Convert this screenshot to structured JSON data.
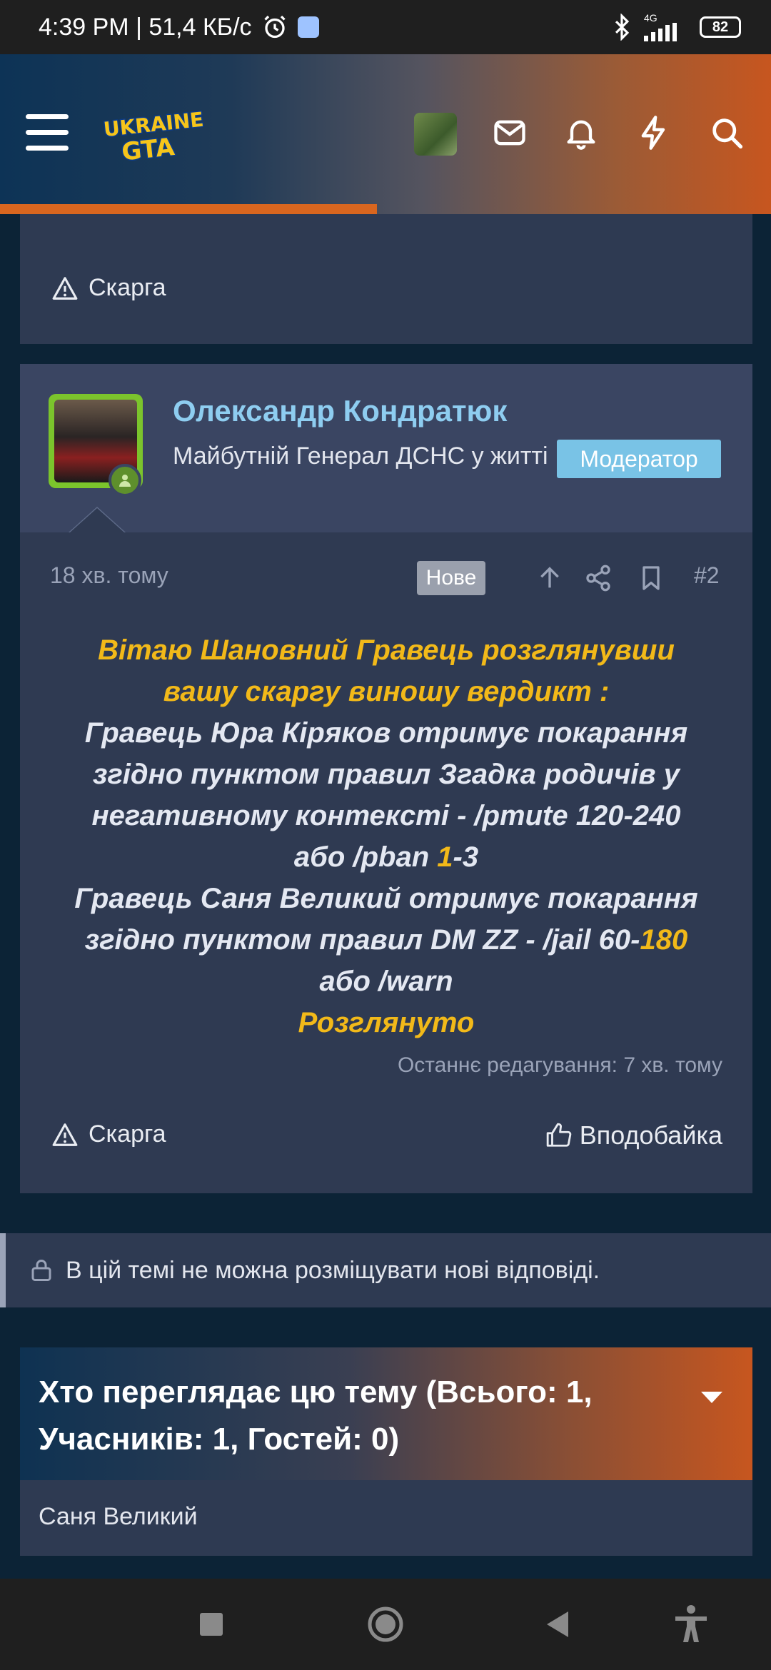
{
  "status_bar": {
    "time_speed": "4:39 PM | 51,4 КБ/с",
    "network": "4G",
    "battery": "82"
  },
  "header": {
    "logo_text_top": "UKRAINE",
    "logo_text_bottom": "GTA"
  },
  "previous_post": {
    "report_label": "Скарга"
  },
  "post": {
    "author": "Олександр Кондратюк",
    "user_title": "Майбутній Генерал ДСНС у житті",
    "role": "Модератор",
    "time": "18 хв. тому",
    "new_badge": "Нове",
    "number": "#2",
    "body": {
      "line1": "Вітаю Шановний Гравець розглянувши",
      "line2": "вашу скаргу виношу вердикт :",
      "line3": "Гравець Юра Кіряков отримує покарання",
      "line4": "згідно пунктом правил Згадка родичів у",
      "line5": "негативному контексті - /pmute 120-240",
      "line6_a": "або /pban ",
      "line6_b": "1",
      "line6_c": "-3",
      "line7": "Гравець Саня Великий отримує покарання",
      "line8_a": "згідно пунктом правил DM ZZ - /jail 60-",
      "line8_b": "180",
      "line9": "або /warn",
      "line10": "Розглянуто"
    },
    "edited": "Останнє редагування: 7 хв. тому",
    "report_label": "Скарга",
    "like_label": "Вподобайка"
  },
  "locked_notice": "В цій темі не можна розміщувати нові відповіді.",
  "who_viewing": {
    "title": "Хто переглядає цю тему (Всього: 1, Учасників: 1, Гостей: 0)",
    "users": [
      "Саня Великий"
    ]
  },
  "colors": {
    "accent_orange": "#c7561f",
    "highlight_yellow": "#f2b919",
    "username_blue": "#8ecdf0",
    "card_bg": "#2e3a52"
  }
}
